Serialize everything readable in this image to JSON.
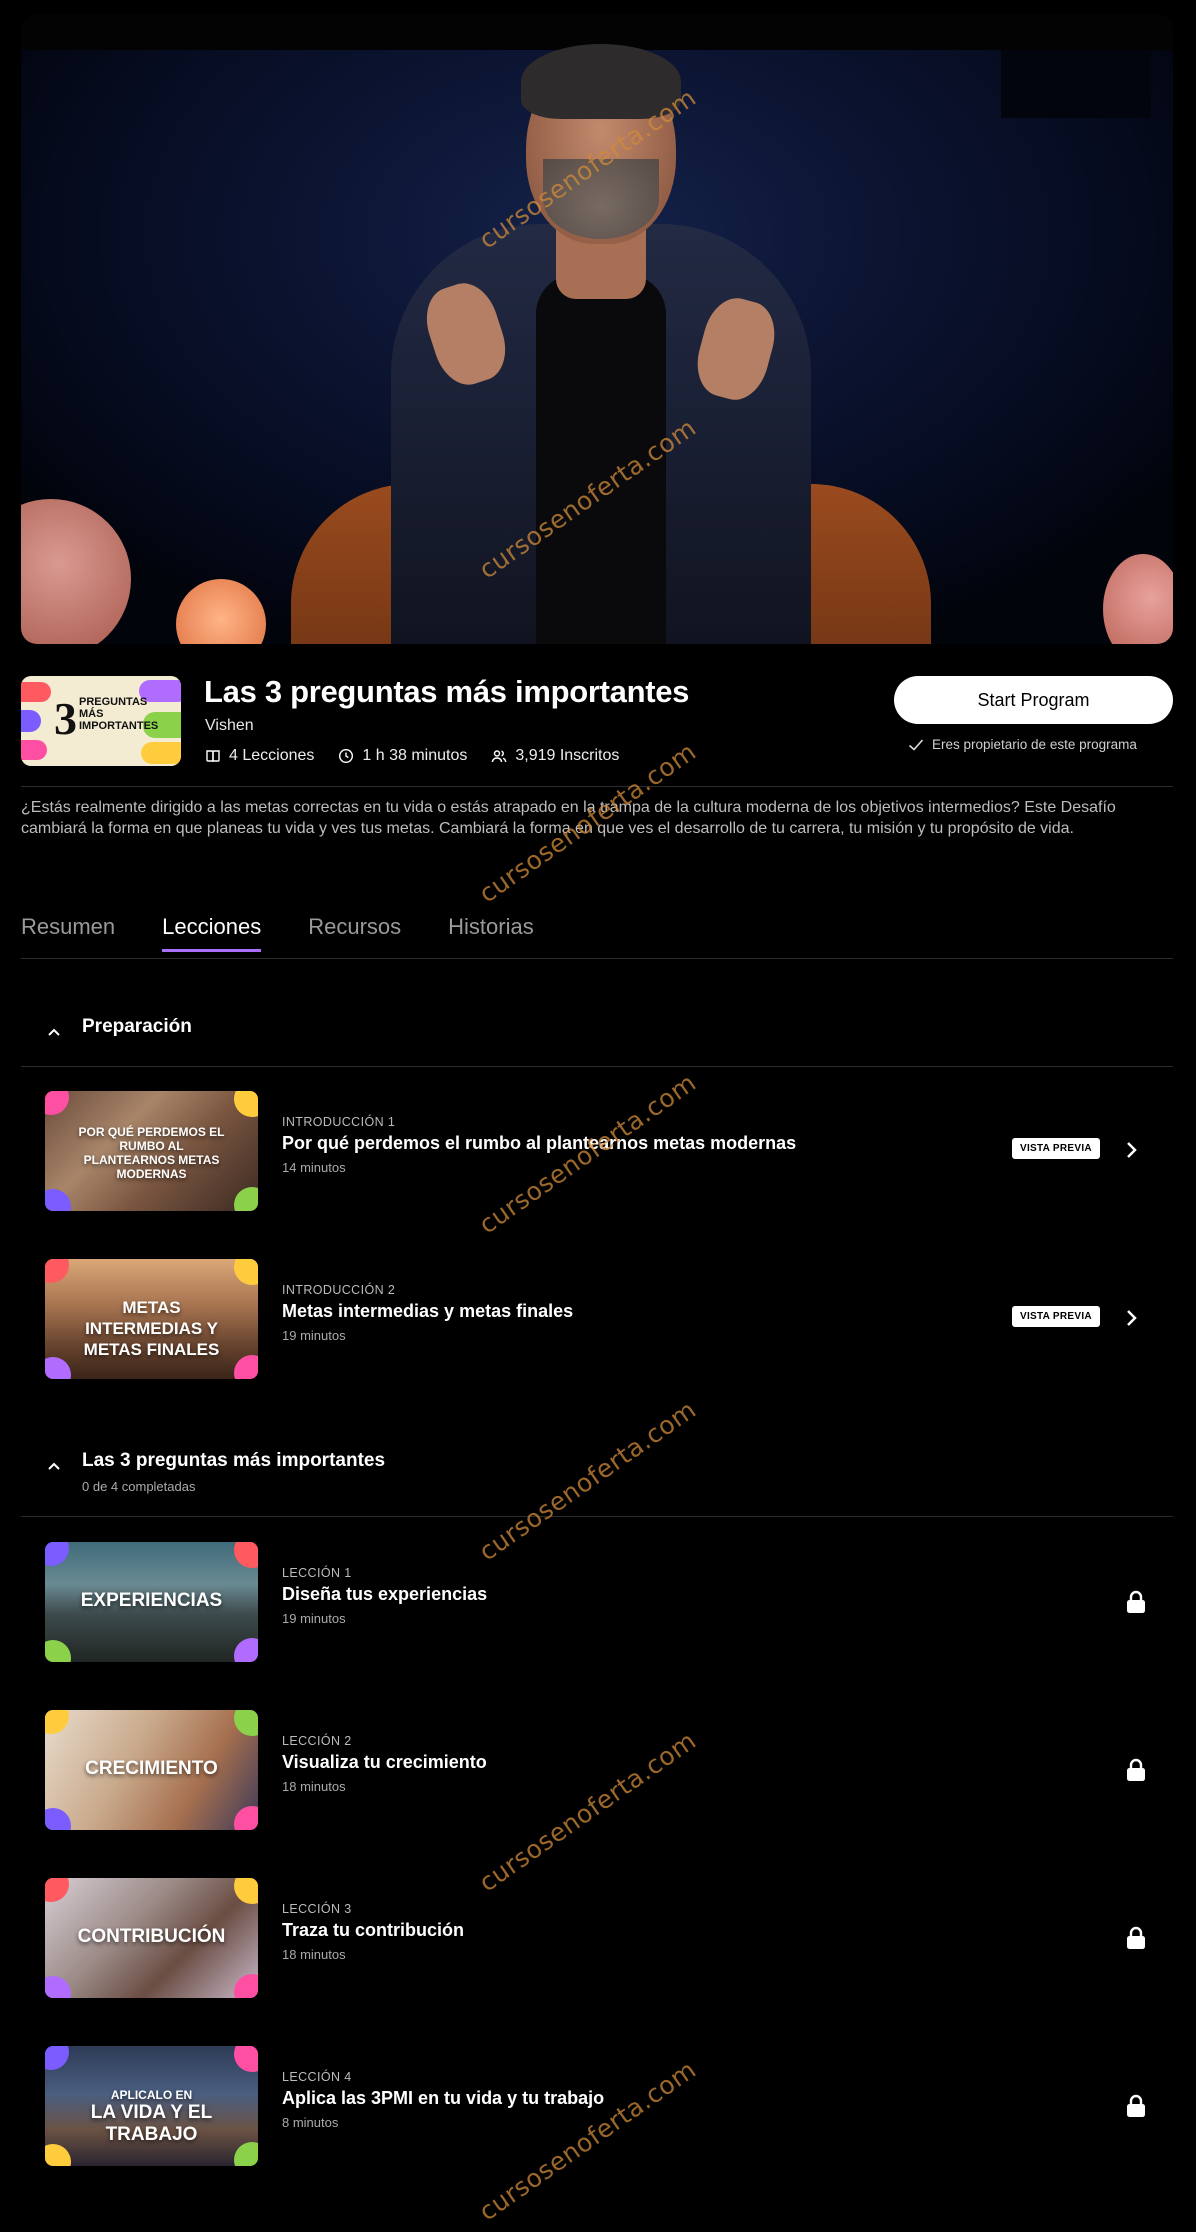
{
  "program": {
    "title": "Las 3 preguntas más importantes",
    "author": "Vishen",
    "lessons_count": "4 Lecciones",
    "duration": "1 h 38 minutos",
    "enrolled": "3,919 Inscritos",
    "description": "¿Estás realmente dirigido a las metas correctas en tu vida o estás atrapado en la trampa de la cultura moderna de los objetivos intermedios? Este Desafío cambiará la forma en que planeas tu vida y ves tus metas. Cambiará la forma en que ves el desarrollo de tu carrera, tu misión y tu propósito de vida.",
    "thumb_text": {
      "number": "3",
      "words": "PREGUNTAS MÁS IMPORTANTES"
    }
  },
  "actions": {
    "start_label": "Start Program",
    "owner_note": "Eres propietario de este programa"
  },
  "tabs": [
    {
      "label": "Resumen",
      "active": false
    },
    {
      "label": "Lecciones",
      "active": true
    },
    {
      "label": "Recursos",
      "active": false
    },
    {
      "label": "Historias",
      "active": false
    }
  ],
  "sections": [
    {
      "title": "Preparación",
      "subtitle": "",
      "lessons": [
        {
          "kicker": "INTRODUCCIÓN 1",
          "title": "Por qué perdemos el rumbo al plantearnos metas modernas",
          "duration": "14 minutos",
          "badge": "VISTA PREVIA",
          "thumb": "POR QUÉ PERDEMOS EL RUMBO AL PLANTEARNOS METAS MODERNAS"
        },
        {
          "kicker": "INTRODUCCIÓN 2",
          "title": "Metas intermedias y metas finales",
          "duration": "19 minutos",
          "badge": "VISTA PREVIA",
          "thumb": "METAS INTERMEDIAS Y METAS FINALES"
        }
      ]
    },
    {
      "title": "Las 3 preguntas más importantes",
      "subtitle": "0 de 4 completadas",
      "lessons": [
        {
          "kicker": "LECCIÓN 1",
          "title": "Diseña tus experiencias",
          "duration": "19 minutos",
          "thumb": "EXPERIENCIAS"
        },
        {
          "kicker": "LECCIÓN 2",
          "title": "Visualiza tu crecimiento",
          "duration": "18 minutos",
          "thumb": "CRECIMIENTO"
        },
        {
          "kicker": "LECCIÓN 3",
          "title": "Traza tu contribución",
          "duration": "18 minutos",
          "thumb": "CONTRIBUCIÓN"
        },
        {
          "kicker": "LECCIÓN 4",
          "title": "Aplica las 3PMI en tu vida y tu trabajo",
          "duration": "8 minutos",
          "thumb_small": "APLICALO EN",
          "thumb": "LA VIDA Y EL TRABAJO"
        }
      ]
    }
  ],
  "watermark": "cursosenoferta.com",
  "colors": {
    "accent": "#a970ff",
    "background": "#000000",
    "button_bg": "#ffffff"
  },
  "icons": [
    "book-icon",
    "clock-icon",
    "users-icon",
    "check-icon",
    "chevron-up-icon",
    "chevron-right-icon",
    "lock-icon"
  ]
}
